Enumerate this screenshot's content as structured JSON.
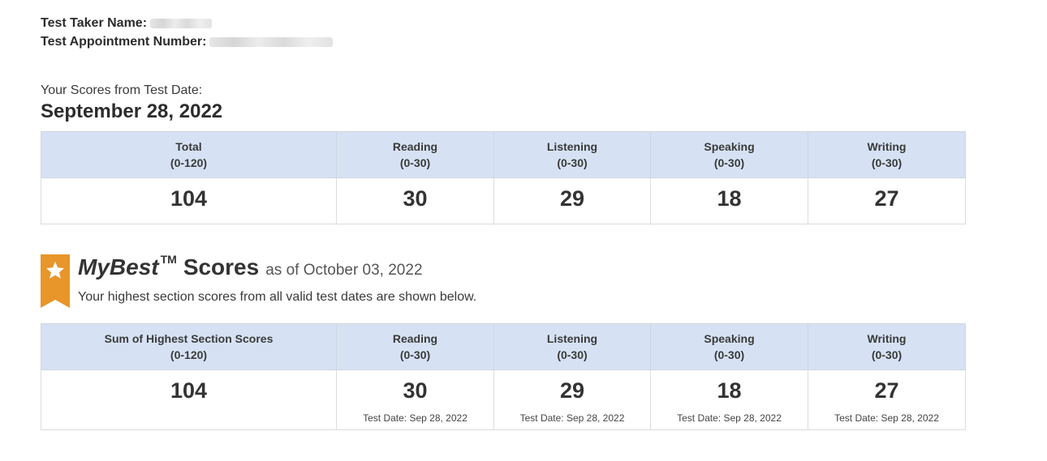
{
  "header": {
    "name_label": "Test Taker Name:",
    "appointment_label": "Test Appointment Number:"
  },
  "scores_from_label": "Your Scores from Test Date:",
  "test_date": "September 28, 2022",
  "current_table": {
    "columns": [
      {
        "label": "Total",
        "range": "(0-120)"
      },
      {
        "label": "Reading",
        "range": "(0-30)"
      },
      {
        "label": "Listening",
        "range": "(0-30)"
      },
      {
        "label": "Speaking",
        "range": "(0-30)"
      },
      {
        "label": "Writing",
        "range": "(0-30)"
      }
    ],
    "values": [
      "104",
      "30",
      "29",
      "18",
      "27"
    ]
  },
  "mybest": {
    "brand": "MyBest",
    "tm": "TM",
    "title_suffix": "Scores",
    "as_of": "as of October 03, 2022",
    "description": "Your highest section scores from all valid test dates are shown below.",
    "icon": "star-ribbon-icon",
    "accent_color": "#e8952a"
  },
  "best_table": {
    "columns": [
      {
        "label": "Sum of Highest Section Scores",
        "range": "(0-120)"
      },
      {
        "label": "Reading",
        "range": "(0-30)"
      },
      {
        "label": "Listening",
        "range": "(0-30)"
      },
      {
        "label": "Speaking",
        "range": "(0-30)"
      },
      {
        "label": "Writing",
        "range": "(0-30)"
      }
    ],
    "values": [
      "104",
      "30",
      "29",
      "18",
      "27"
    ],
    "dates": [
      "",
      "Test Date: Sep 28, 2022",
      "Test Date: Sep 28, 2022",
      "Test Date: Sep 28, 2022",
      "Test Date: Sep 28, 2022"
    ]
  },
  "colors": {
    "header_bg": "#d6e2f3",
    "ribbon": "#e8952a"
  }
}
